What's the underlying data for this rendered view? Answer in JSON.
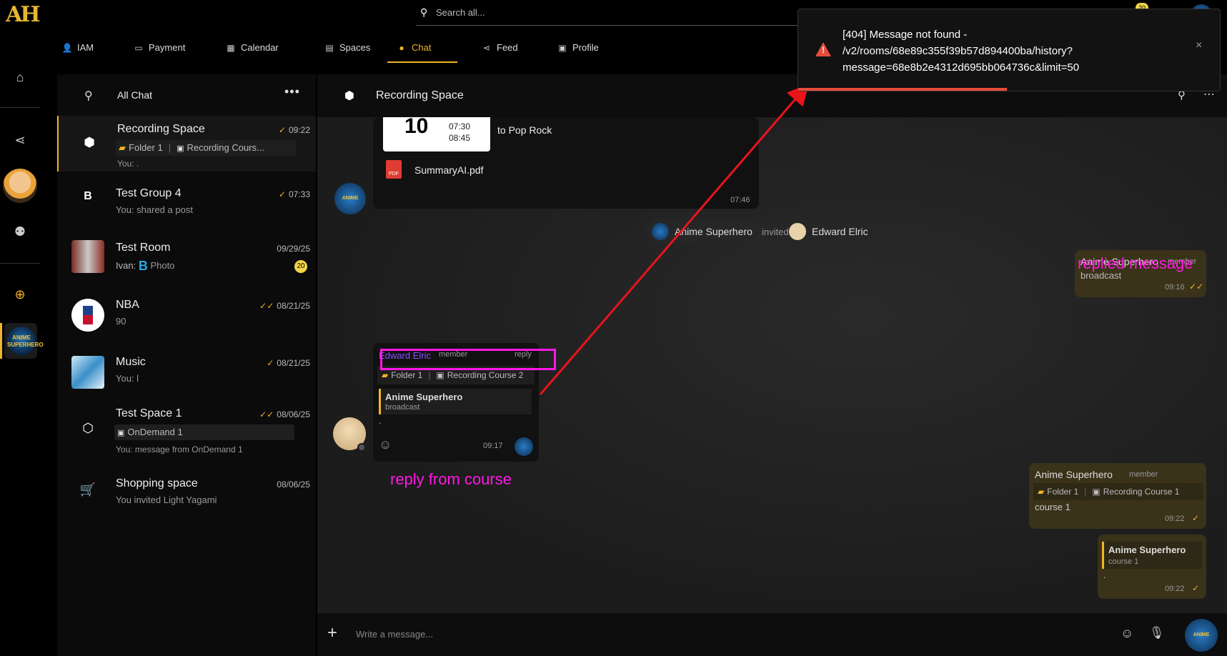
{
  "app": {
    "logo_text": "AH"
  },
  "rail": {
    "icons": [
      "store-icon",
      "share-icon",
      "user-icon",
      "add-icon"
    ]
  },
  "topbar": {
    "search_placeholder": "Search all...",
    "notification_count": "20",
    "tabs": [
      {
        "label": "IAM",
        "icon": "user-icon"
      },
      {
        "label": "Payment",
        "icon": "card-icon"
      },
      {
        "label": "Calendar",
        "icon": "calendar-icon"
      },
      {
        "label": "Spaces",
        "icon": "database-icon"
      },
      {
        "label": "Chat",
        "icon": "chat-icon",
        "active": true
      },
      {
        "label": "Feed",
        "icon": "share-icon"
      },
      {
        "label": "Profile",
        "icon": "id-card-icon"
      }
    ]
  },
  "chatlist": {
    "title": "All Chat",
    "items": [
      {
        "name": "Recording Space",
        "time": "09:22",
        "check": "✓",
        "folder": "Folder 1",
        "course": "Recording Cours...",
        "sub": "You: ."
      },
      {
        "name": "Test Group 4",
        "time": "07:33",
        "check": "✓",
        "sub": "You: shared a post",
        "avatar": "B"
      },
      {
        "name": "Test Room",
        "time": "09/29/25",
        "sub_prefix": "Ivan:",
        "sub": "Photo",
        "badge": "20",
        "sub_icon": "B"
      },
      {
        "name": "NBA",
        "time": "08/21/25",
        "check": "✓✓",
        "sub": "90"
      },
      {
        "name": "Music",
        "time": "08/21/25",
        "check": "✓",
        "sub": "You: l"
      },
      {
        "name": "Test Space 1",
        "time": "08/06/25",
        "check": "✓✓",
        "course": "OnDemand 1",
        "sub": "You: message from OnDemand 1"
      },
      {
        "name": "Shopping space",
        "time": "08/06/25",
        "sub": "You invited Light Yagami"
      }
    ]
  },
  "main": {
    "room_title": "Recording Space",
    "composer_placeholder": "Write a message...",
    "event_card": {
      "day": "10",
      "time_start": "07:30",
      "time_end": "08:45",
      "title": "to Pop Rock"
    },
    "file": {
      "name": "SummaryAI.pdf",
      "time": "07:46"
    },
    "system": {
      "actor": "Anime Superhero",
      "verb": "invited",
      "target": "Edward Elric"
    },
    "reply_msg": {
      "author": "Edward Elric",
      "role": "member",
      "reply_label": "reply",
      "folder": "Folder 1",
      "course": "Recording Course 2",
      "quote_author": "Anime Superhero",
      "quote_text": "broadcast",
      "text": ".",
      "time": "09:17"
    },
    "right_msg1": {
      "author": "Anime Superhero",
      "role": "member",
      "text": "broadcast",
      "time": "09:16",
      "check": "✓✓"
    },
    "right_msg2": {
      "author": "Anime Superhero",
      "role": "member",
      "folder": "Folder 1",
      "course": "Recording Course 1",
      "text": "course 1",
      "time": "09:22",
      "check": "✓"
    },
    "right_msg3": {
      "quote_author": "Anime Superhero",
      "quote_text": "course 1",
      "text": ".",
      "time": "09:22",
      "check": "✓"
    }
  },
  "toast": {
    "message": "[404] Message not found - /v2/rooms/68e89c355f39b57d894400ba/history?message=68e8b2e4312d695bb064736c&limit=50",
    "line1": "[404] Message not found -",
    "line2": "/v2/rooms/68e89c355f39b57d894400ba/history?",
    "line3": "message=68e8b2e4312d695bb064736c&limit=50",
    "close": "×",
    "progress": 0.5
  },
  "annotations": {
    "replied": "replied message",
    "reply_from_course": "reply from course",
    "colors": {
      "annotation": "#ff18e5",
      "arrow": "#e8141a",
      "accent": "#f0b429"
    }
  }
}
